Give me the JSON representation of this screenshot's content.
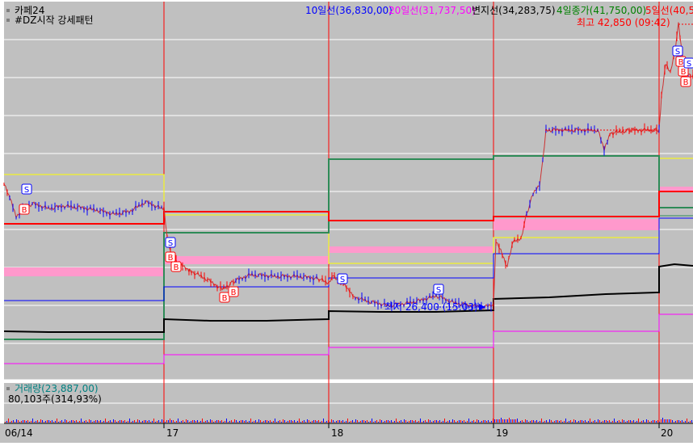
{
  "chart": {
    "legend_line1": {
      "title": "카페24",
      "ma10": "10일선(36,830,00)",
      "ma20": "20일선(31,737,50)",
      "pivot": "변지선(34,283,75)",
      "close4": "4일종가(41,750,00)",
      "ma5": "5일선(40,5"
    },
    "legend_line2": "#DZ시작 강세패턴",
    "high_label": "최고 42,850 (09:42)",
    "low_label": "최저 26,400 (15:03)",
    "volume_legend": "거래량(23,887,00)",
    "volume_value": "80,103주(314,93%)",
    "signal_buy": "B",
    "signal_sell": "S",
    "x_labels": [
      "06/14",
      "17",
      "18",
      "19",
      "20"
    ],
    "colors": {
      "background": "#c0c0c0",
      "ma10": "#0000ff",
      "ma20": "#ff00ff",
      "pivot": "#000000",
      "close4": "#008000",
      "ma5": "#ff0000",
      "pink_band": "#ff99cc",
      "yellow_line": "#ffff00",
      "day_separator": "#ff0000"
    }
  },
  "chart_data": {
    "type": "line",
    "x": [
      "06/14",
      "17",
      "18",
      "19",
      "20"
    ],
    "series": [
      {
        "name": "10일선",
        "values": []
      },
      {
        "name": "20일선",
        "values": []
      },
      {
        "name": "변지선",
        "values": []
      },
      {
        "name": "4일종가",
        "values": []
      },
      {
        "name": "5일선",
        "values": []
      }
    ],
    "annotations": [
      "최고 42,850 (09:42)",
      "최저 26,400 (15:03)"
    ]
  }
}
